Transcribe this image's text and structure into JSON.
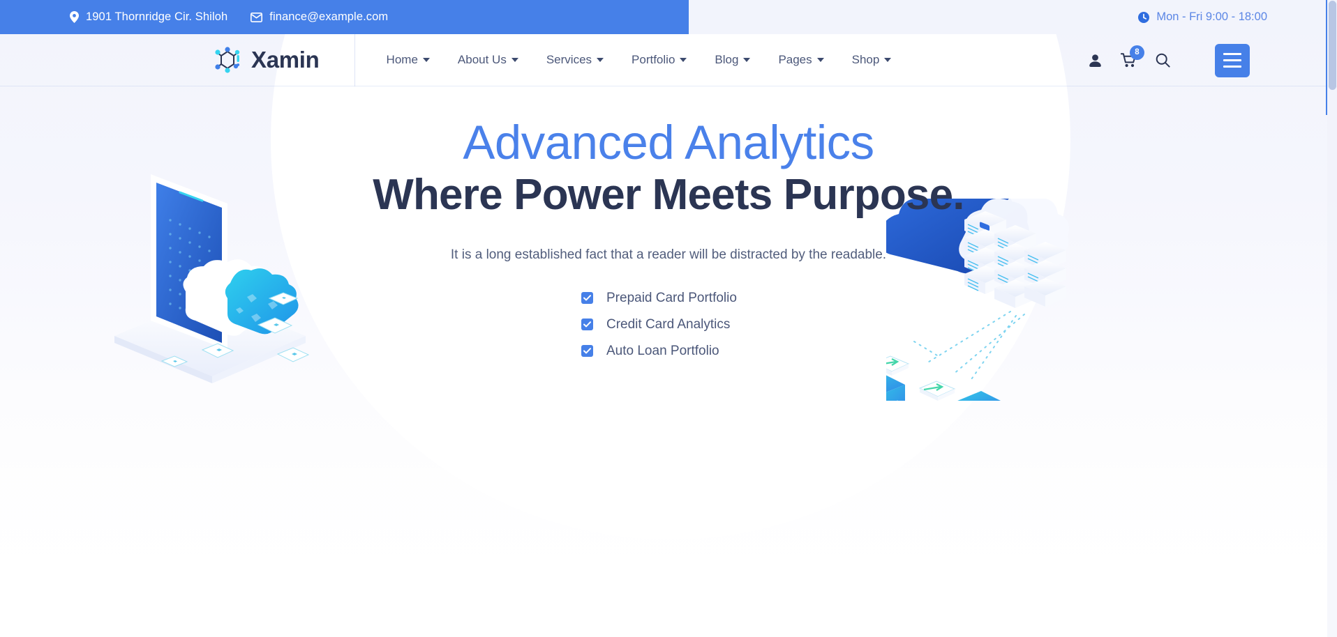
{
  "topbar": {
    "address": "1901 Thornridge Cir. Shiloh",
    "address_icon": "map-pin-icon",
    "email": "finance@example.com",
    "email_icon": "envelope-icon",
    "hours": "Mon - Fri 9:00 - 18:00",
    "hours_icon": "clock-icon",
    "bar_color": "#4680e8",
    "hours_color": "#5b86e5"
  },
  "header": {
    "brand_name": "Xamin",
    "brand_icon": "network-nodes-logo-icon",
    "nav": [
      {
        "label": "Home",
        "caret": "chevron-down-icon"
      },
      {
        "label": "About Us",
        "caret": "chevron-down-icon"
      },
      {
        "label": "Services",
        "caret": "chevron-down-icon"
      },
      {
        "label": "Portfolio",
        "caret": "chevron-down-icon"
      },
      {
        "label": "Blog",
        "caret": "chevron-down-icon"
      },
      {
        "label": "Pages",
        "caret": "chevron-down-icon"
      },
      {
        "label": "Shop",
        "caret": "chevron-down-icon"
      }
    ],
    "account_icon": "user-icon",
    "cart_icon": "shopping-cart-icon",
    "cart_count": "8",
    "search_icon": "search-icon",
    "menu_icon": "hamburger-menu-icon",
    "accent_color": "#4680e8"
  },
  "hero": {
    "headline_top": "Advanced Analytics",
    "headline_bottom": "Where Power Meets Purpose.",
    "headline_top_color": "#4a81ea",
    "headline_bottom_color": "#2b3553",
    "subtext": "It is a long established fact that a reader will be distracted by the readable.",
    "features": [
      {
        "label": "Prepaid Card Portfolio",
        "checked": true
      },
      {
        "label": "Credit Card Analytics",
        "checked": true
      },
      {
        "label": "Auto Loan Portfolio",
        "checked": true
      }
    ],
    "illustration_left": "isometric-tablet-cloud-illustration",
    "illustration_right": "isometric-cloud-servers-network-illustration"
  },
  "browser": {
    "scrollbar": "vertical-scrollbar"
  }
}
